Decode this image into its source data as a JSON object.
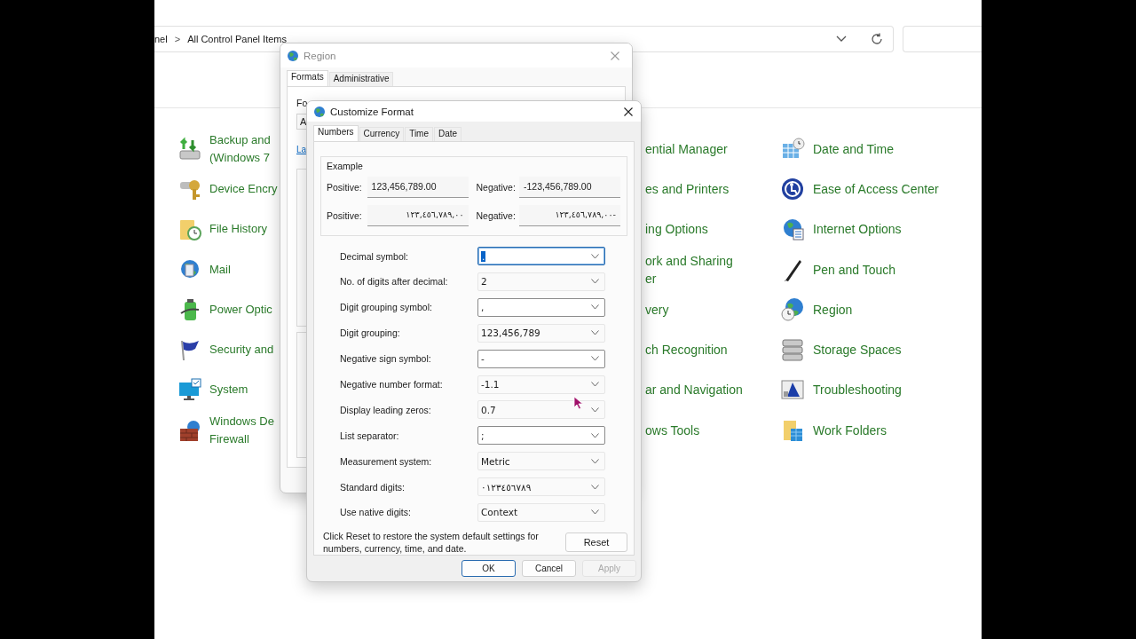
{
  "address_bar": {
    "breadcrumb": [
      "nel",
      "All Control Panel Items"
    ],
    "separator": ">"
  },
  "control_panel": {
    "columns": [
      {
        "items": [
          {
            "label": "Backup and\n(Windows 7"
          },
          {
            "label": "Device Encry"
          },
          {
            "label": "File History"
          },
          {
            "label": "Mail"
          },
          {
            "label": "Power Optic"
          },
          {
            "label": "Security and"
          },
          {
            "label": "System"
          },
          {
            "label": "Windows De\nFirewall"
          }
        ]
      },
      {
        "items": [
          {
            "label": "ential Manager"
          },
          {
            "label": "es and Printers"
          },
          {
            "label": "ing Options"
          },
          {
            "label": "ork and Sharing\ner"
          },
          {
            "label": "very"
          },
          {
            "label": "ch Recognition"
          },
          {
            "label": "ar and Navigation"
          },
          {
            "label": "ows Tools"
          }
        ]
      },
      {
        "items": [
          {
            "label": "Date and Time"
          },
          {
            "label": "Ease of Access Center"
          },
          {
            "label": "Internet Options"
          },
          {
            "label": "Pen and Touch"
          },
          {
            "label": "Region"
          },
          {
            "label": "Storage Spaces"
          },
          {
            "label": "Troubleshooting"
          },
          {
            "label": "Work Folders"
          }
        ]
      }
    ]
  },
  "region_dialog": {
    "title": "Region",
    "tabs": [
      {
        "label": "Formats",
        "selected": true
      },
      {
        "label": "Administrative",
        "selected": false
      }
    ],
    "fragments": [
      {
        "kind": "label",
        "text": "Fo"
      },
      {
        "kind": "field",
        "text": "A"
      },
      {
        "kind": "link",
        "text": "La"
      },
      {
        "kind": "group"
      },
      {
        "kind": "group"
      }
    ]
  },
  "customize_dialog": {
    "title": "Customize Format",
    "tabs": [
      {
        "label": "Numbers",
        "selected": true
      },
      {
        "label": "Currency",
        "selected": false
      },
      {
        "label": "Time",
        "selected": false
      },
      {
        "label": "Date",
        "selected": false
      }
    ],
    "example": {
      "title": "Example",
      "rows": [
        {
          "positive_label": "Positive:",
          "positive_value": "123,456,789.00",
          "negative_label": "Negative:",
          "negative_value": "-123,456,789.00",
          "kind": "latin"
        },
        {
          "positive_label": "Positive:",
          "positive_value": "١٢٣,٤٥٦,٧٨٩,٠٠",
          "negative_label": "Negative:",
          "negative_value": "١٢٣,٤٥٦,٧٨٩,٠٠-",
          "kind": "native"
        }
      ]
    },
    "settings": [
      {
        "label": "Decimal symbol:",
        "value": ".",
        "kind": "editable",
        "focused": true
      },
      {
        "label": "No. of digits after decimal:",
        "value": "2",
        "kind": "list",
        "focused": false
      },
      {
        "label": "Digit grouping symbol:",
        "value": ",",
        "kind": "editable",
        "focused": false
      },
      {
        "label": "Digit grouping:",
        "value": "123,456,789",
        "kind": "list",
        "focused": false
      },
      {
        "label": "Negative sign symbol:",
        "value": "-",
        "kind": "editable",
        "focused": false
      },
      {
        "label": "Negative number format:",
        "value": "-1.1",
        "kind": "list",
        "focused": false
      },
      {
        "label": "Display leading zeros:",
        "value": "0.7",
        "kind": "list",
        "focused": false
      },
      {
        "label": "List separator:",
        "value": ";",
        "kind": "editable",
        "focused": false
      },
      {
        "label": "Measurement system:",
        "value": "Metric",
        "kind": "list",
        "focused": false
      },
      {
        "label": "Standard digits:",
        "value": "٠١٢٣٤٥٦٧٨٩",
        "kind": "list",
        "focused": false
      },
      {
        "label": "Use native digits:",
        "value": "Context",
        "kind": "list",
        "focused": false
      }
    ],
    "reset_note": "Click Reset to restore the system default settings for numbers, currency, time, and date.",
    "reset_button": "Reset",
    "buttons": [
      {
        "label": "OK",
        "default": true,
        "disabled": false
      },
      {
        "label": "Cancel",
        "default": false,
        "disabled": false
      },
      {
        "label": "Apply",
        "default": false,
        "disabled": true
      }
    ]
  }
}
